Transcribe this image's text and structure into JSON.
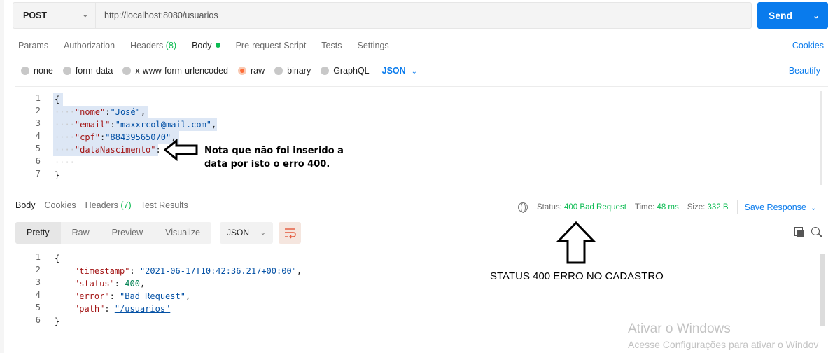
{
  "request": {
    "method": "POST",
    "url": "http://localhost:8080/usuarios",
    "send_label": "Send",
    "tabs": [
      {
        "label": "Params"
      },
      {
        "label": "Authorization"
      },
      {
        "label": "Headers",
        "count": "(8)"
      },
      {
        "label": "Body",
        "active": true
      },
      {
        "label": "Pre-request Script"
      },
      {
        "label": "Tests"
      },
      {
        "label": "Settings"
      }
    ],
    "cookies_label": "Cookies",
    "body_types": [
      "none",
      "form-data",
      "x-www-form-urlencoded",
      "raw",
      "binary",
      "GraphQL"
    ],
    "selected_body_type": "raw",
    "format": "JSON",
    "beautify_label": "Beautify",
    "editor": {
      "line_numbers": [
        "1",
        "2",
        "3",
        "4",
        "5",
        "6",
        "7"
      ],
      "open_brace": "{",
      "close_brace": "}",
      "fields": [
        {
          "key": "\"nome\"",
          "value": "\"José\"",
          "trail": ","
        },
        {
          "key": "\"email\"",
          "value": "\"maxxrcol@mail.com\"",
          "trail": ","
        },
        {
          "key": "\"cpf\"",
          "value": "\"88439565070\"",
          "trail": ","
        },
        {
          "key": "\"dataNascimento\"",
          "value": "",
          "trail": ":"
        }
      ]
    }
  },
  "annotation": {
    "request_note": "Nota que não foi inserido a data por isto o erro 400.",
    "status_note": "STATUS 400 ERRO NO CADASTRO"
  },
  "response": {
    "tabs": [
      {
        "label": "Body",
        "active": true
      },
      {
        "label": "Cookies"
      },
      {
        "label": "Headers",
        "count": "(7)"
      },
      {
        "label": "Test Results"
      }
    ],
    "status_label": "Status:",
    "status_value": "400 Bad Request",
    "time_label": "Time:",
    "time_value": "48 ms",
    "size_label": "Size:",
    "size_value": "332 B",
    "save_label": "Save Response",
    "views": [
      "Pretty",
      "Raw",
      "Preview",
      "Visualize"
    ],
    "format": "JSON",
    "body": {
      "line_numbers": [
        "1",
        "2",
        "3",
        "4",
        "5",
        "6"
      ],
      "open_brace": "{",
      "close_brace": "}",
      "fields": [
        {
          "key": "\"timestamp\"",
          "value": "\"2021-06-17T10:42:36.217+00:00\"",
          "trail": ","
        },
        {
          "key": "\"status\"",
          "value": "400",
          "trail": ","
        },
        {
          "key": "\"error\"",
          "value": "\"Bad Request\"",
          "trail": ","
        },
        {
          "key": "\"path\"",
          "value": "\"/usuarios\"",
          "trail": ""
        }
      ]
    }
  },
  "watermark": {
    "title": "Ativar o Windows",
    "subtitle": "Acesse Configurações para ativar o Windov"
  },
  "colors": {
    "accent": "#097bed",
    "success": "#0cbb52",
    "selected_radio": "#ff6c37"
  }
}
